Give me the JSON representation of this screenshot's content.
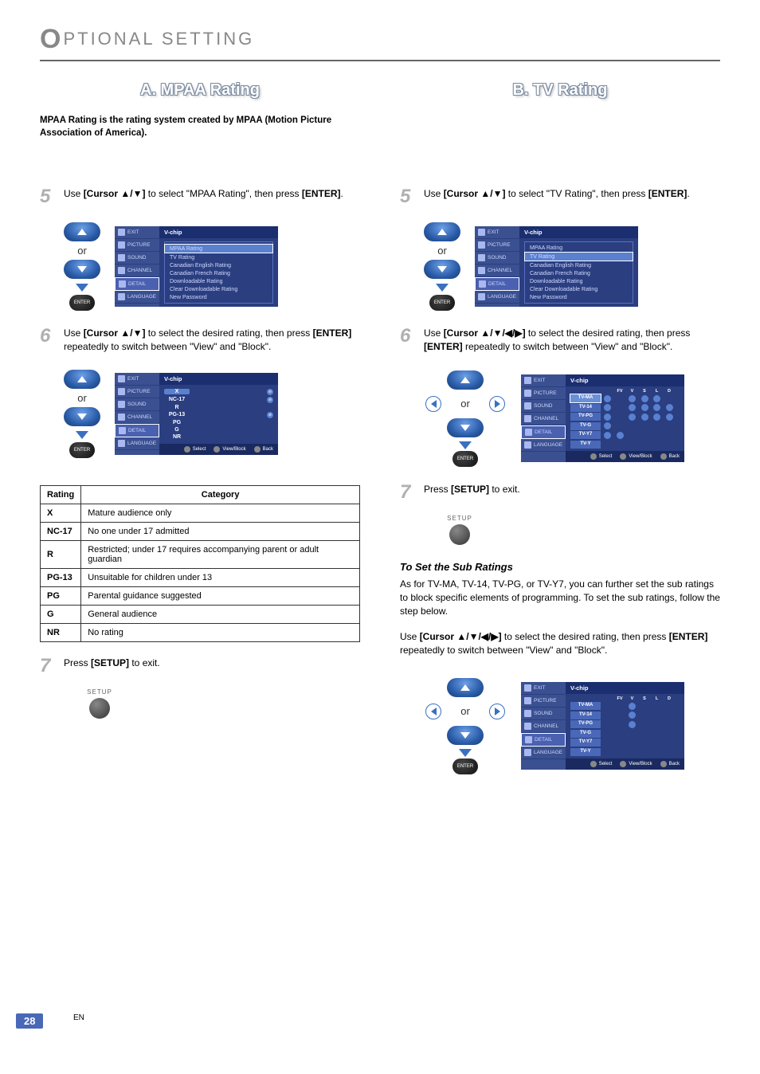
{
  "header": {
    "title_prefix": "O",
    "title_rest": "PTIONAL SETTING"
  },
  "left": {
    "section_title": "A. MPAA Rating",
    "intro": "MPAA Rating is the rating system created by MPAA (Motion Picture Association of America).",
    "step5_pre": "Use ",
    "step5_cursor": "[Cursor ▲/▼]",
    "step5_mid": " to select \"MPAA Rating\", then press ",
    "step5_enter": "[ENTER]",
    "step5_post": ".",
    "or": "or",
    "enter_label": "ENTER",
    "step6_pre": "Use ",
    "step6_cursor": "[Cursor ▲/▼]",
    "step6_mid": " to select the desired rating, then press ",
    "step6_enter": "[ENTER]",
    "step6_post": " repeatedly to switch between \"View\" and \"Block\".",
    "step7_pre": "Press ",
    "step7_setup": "[SETUP]",
    "step7_post": " to exit.",
    "setup_label": "SETUP",
    "osd_side": [
      "EXIT",
      "PICTURE",
      "SOUND",
      "CHANNEL",
      "DETAIL",
      "LANGUAGE"
    ],
    "osd1_title": "V-chip",
    "osd1_items": [
      "MPAA Rating",
      "TV Rating",
      "Canadian English Rating",
      "Canadian French Rating",
      "Downloadable Rating",
      "Clear Downloadable Rating",
      "New Password"
    ],
    "osd2_title": "V-chip",
    "osd2_ratings": [
      "X",
      "NC-17",
      "R",
      "PG-13",
      "PG",
      "G",
      "NR"
    ],
    "osd_footer_select": "Select",
    "osd_footer_viewblock": "View/Block",
    "osd_footer_back": "Back",
    "table_head_rating": "Rating",
    "table_head_category": "Category",
    "table_rows": [
      {
        "r": "X",
        "c": "Mature audience only"
      },
      {
        "r": "NC-17",
        "c": "No one under 17 admitted"
      },
      {
        "r": "R",
        "c": "Restricted; under 17 requires accompanying parent or adult guardian"
      },
      {
        "r": "PG-13",
        "c": "Unsuitable for children under 13"
      },
      {
        "r": "PG",
        "c": "Parental guidance suggested"
      },
      {
        "r": "G",
        "c": "General audience"
      },
      {
        "r": "NR",
        "c": "No rating"
      }
    ]
  },
  "right": {
    "section_title": "B. TV Rating",
    "step5_pre": "Use ",
    "step5_cursor": "[Cursor ▲/▼]",
    "step5_mid": " to select \"TV Rating\", then press ",
    "step5_enter": "[ENTER]",
    "step5_post": ".",
    "or": "or",
    "enter_label": "ENTER",
    "step6_pre": "Use ",
    "step6_cursor": "[Cursor ▲/▼/◀/▶]",
    "step6_mid": " to select the desired rating, then press ",
    "step6_enter": "[ENTER]",
    "step6_post": " repeatedly to switch between \"View\" and \"Block\".",
    "step7_pre": "Press ",
    "step7_setup": "[SETUP]",
    "step7_post": " to exit.",
    "setup_label": "SETUP",
    "osd_side": [
      "EXIT",
      "PICTURE",
      "SOUND",
      "CHANNEL",
      "DETAIL",
      "LANGUAGE"
    ],
    "osd1_title": "V-chip",
    "osd1_items": [
      "MPAA Rating",
      "TV Rating",
      "Canadian English Rating",
      "Canadian French Rating",
      "Downloadable Rating",
      "Clear Downloadable Rating",
      "New Password"
    ],
    "osd2_title": "V-chip",
    "osd2_headers": [
      "FV",
      "V",
      "S",
      "L",
      "D"
    ],
    "osd2_rows": [
      "TV-MA",
      "TV-14",
      "TV-PG",
      "TV-G",
      "TV-Y7",
      "TV-Y"
    ],
    "osd_footer_select": "Select",
    "osd_footer_viewblock": "View/Block",
    "osd_footer_back": "Back",
    "sub_heading": "To Set the Sub Ratings",
    "sub_para": "As for TV-MA, TV-14, TV-PG, or TV-Y7, you can further set the sub ratings to block specific elements of programming. To set the sub ratings, follow the step below.",
    "sub_step_pre": "Use ",
    "sub_step_cursor": "[Cursor ▲/▼/◀/▶]",
    "sub_step_mid": " to select the desired rating, then press ",
    "sub_step_enter": "[ENTER]",
    "sub_step_post": " repeatedly to switch between \"View\" and \"Block\"."
  },
  "page": {
    "number": "28",
    "lang": "EN"
  }
}
